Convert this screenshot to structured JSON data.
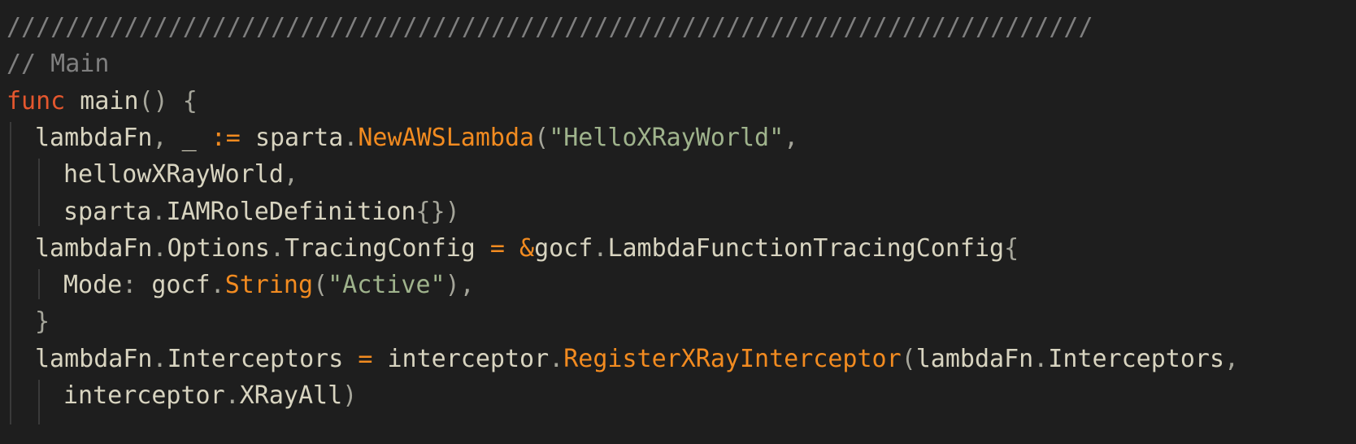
{
  "editor": {
    "colors": {
      "background": "#1e1e1e",
      "comment": "#7f7f7f",
      "keyword": "#e4572e",
      "function": "#f28b20",
      "string": "#9fb38c",
      "text": "#d8d4c0"
    },
    "lines": [
      {
        "indent": 0,
        "tokens": [
          {
            "t": "comment",
            "v": "//////////////////////////////////////////////////////////////////////////"
          }
        ]
      },
      {
        "indent": 0,
        "tokens": [
          {
            "t": "comment",
            "v": "// Main"
          }
        ]
      },
      {
        "indent": 0,
        "tokens": [
          {
            "t": "keyword",
            "v": "func"
          },
          {
            "t": "ident",
            "v": " main"
          },
          {
            "t": "punct",
            "v": "() {"
          }
        ]
      },
      {
        "indent": 1,
        "tokens": [
          {
            "t": "ident",
            "v": "lambdaFn"
          },
          {
            "t": "punct",
            "v": ", "
          },
          {
            "t": "ident",
            "v": "_"
          },
          {
            "t": "op",
            "v": " := "
          },
          {
            "t": "ident",
            "v": "sparta"
          },
          {
            "t": "punct",
            "v": "."
          },
          {
            "t": "func",
            "v": "NewAWSLambda"
          },
          {
            "t": "punct",
            "v": "("
          },
          {
            "t": "string",
            "v": "\"HelloXRayWorld\""
          },
          {
            "t": "punct",
            "v": ","
          }
        ]
      },
      {
        "indent": 2,
        "tokens": [
          {
            "t": "ident",
            "v": "hellowXRayWorld"
          },
          {
            "t": "punct",
            "v": ","
          }
        ]
      },
      {
        "indent": 2,
        "tokens": [
          {
            "t": "ident",
            "v": "sparta"
          },
          {
            "t": "punct",
            "v": "."
          },
          {
            "t": "ident",
            "v": "IAMRoleDefinition"
          },
          {
            "t": "punct",
            "v": "{})"
          }
        ]
      },
      {
        "indent": 1,
        "tokens": [
          {
            "t": "ident",
            "v": "lambdaFn"
          },
          {
            "t": "punct",
            "v": "."
          },
          {
            "t": "ident",
            "v": "Options"
          },
          {
            "t": "punct",
            "v": "."
          },
          {
            "t": "ident",
            "v": "TracingConfig"
          },
          {
            "t": "op",
            "v": " = &"
          },
          {
            "t": "ident",
            "v": "gocf"
          },
          {
            "t": "punct",
            "v": "."
          },
          {
            "t": "ident",
            "v": "LambdaFunctionTracingConfig"
          },
          {
            "t": "punct",
            "v": "{"
          }
        ]
      },
      {
        "indent": 2,
        "tokens": [
          {
            "t": "ident",
            "v": "Mode"
          },
          {
            "t": "punct",
            "v": ": "
          },
          {
            "t": "ident",
            "v": "gocf"
          },
          {
            "t": "punct",
            "v": "."
          },
          {
            "t": "func",
            "v": "String"
          },
          {
            "t": "punct",
            "v": "("
          },
          {
            "t": "string",
            "v": "\"Active\""
          },
          {
            "t": "punct",
            "v": "),"
          }
        ]
      },
      {
        "indent": 1,
        "tokens": [
          {
            "t": "punct",
            "v": "}"
          }
        ]
      },
      {
        "indent": 1,
        "tokens": [
          {
            "t": "ident",
            "v": "lambdaFn"
          },
          {
            "t": "punct",
            "v": "."
          },
          {
            "t": "ident",
            "v": "Interceptors"
          },
          {
            "t": "op",
            "v": " = "
          },
          {
            "t": "ident",
            "v": "interceptor"
          },
          {
            "t": "punct",
            "v": "."
          },
          {
            "t": "func",
            "v": "RegisterXRayInterceptor"
          },
          {
            "t": "punct",
            "v": "("
          },
          {
            "t": "ident",
            "v": "lambdaFn"
          },
          {
            "t": "punct",
            "v": "."
          },
          {
            "t": "ident",
            "v": "Interceptors"
          },
          {
            "t": "punct",
            "v": ","
          }
        ]
      },
      {
        "indent": 2,
        "tokens": [
          {
            "t": "ident",
            "v": "interceptor"
          },
          {
            "t": "punct",
            "v": "."
          },
          {
            "t": "ident",
            "v": "XRayAll"
          },
          {
            "t": "punct",
            "v": ")"
          }
        ]
      }
    ]
  }
}
